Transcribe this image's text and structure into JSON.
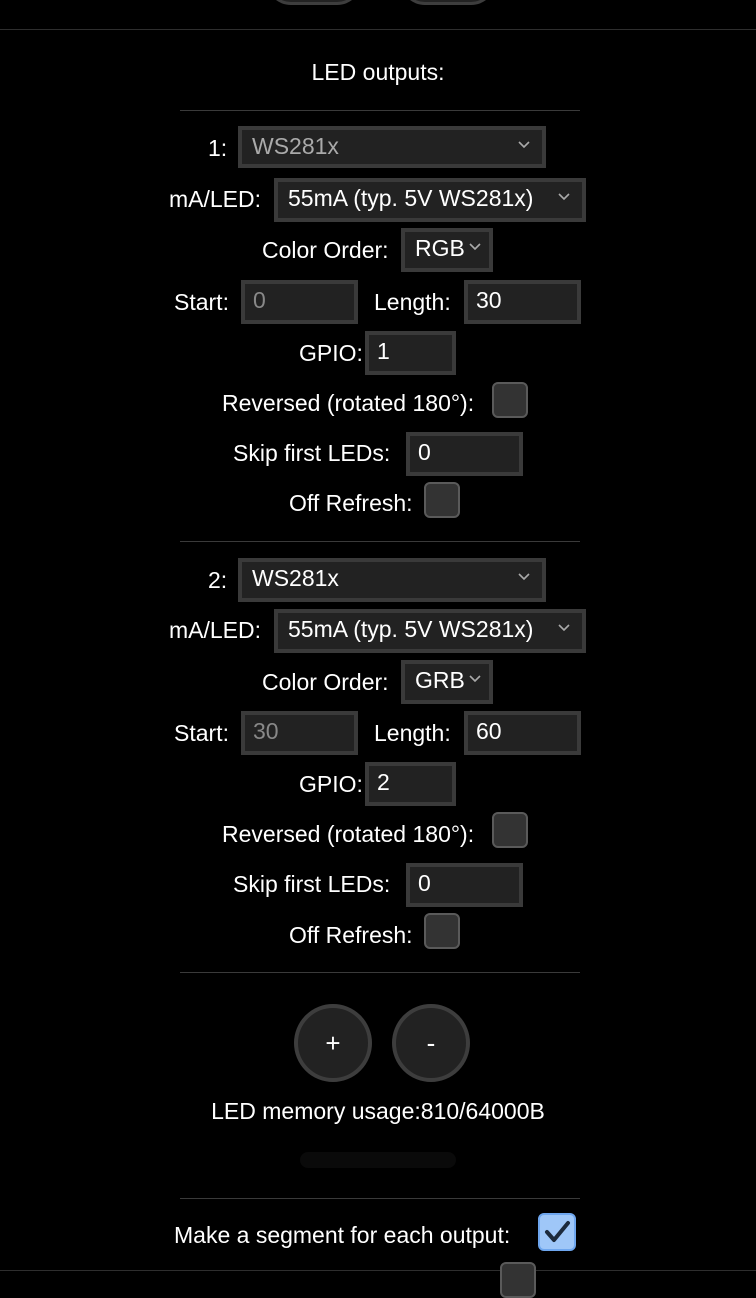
{
  "title": "LED outputs:",
  "outputs": [
    {
      "index_label": "1:",
      "type": "WS281x",
      "ma_label": "mA/LED:",
      "ma_value": "55mA (typ. 5V WS281x)",
      "color_order_label": "Color Order:",
      "color_order": "RGB",
      "start_label": "Start:",
      "start": "0",
      "length_label": "Length:",
      "length": "30",
      "gpio_label": "GPIO:",
      "gpio": "1",
      "reversed_label": "Reversed (rotated 180°):",
      "reversed": false,
      "skip_label": "Skip first LEDs:",
      "skip": "0",
      "off_refresh_label": "Off Refresh:",
      "off_refresh": false
    },
    {
      "index_label": "2:",
      "type": "WS281x",
      "ma_label": "mA/LED:",
      "ma_value": "55mA (typ. 5V WS281x)",
      "color_order_label": "Color Order:",
      "color_order": "GRB",
      "start_label": "Start:",
      "start": "30",
      "length_label": "Length:",
      "length": "60",
      "gpio_label": "GPIO:",
      "gpio": "2",
      "reversed_label": "Reversed (rotated 180°):",
      "reversed": false,
      "skip_label": "Skip first LEDs:",
      "skip": "0",
      "off_refresh_label": "Off Refresh:",
      "off_refresh": false
    }
  ],
  "buttons": {
    "add": "+",
    "remove": "-"
  },
  "memory": "LED memory usage:810/64000B",
  "segment_label": "Make a segment for each output:",
  "segment_checked": true,
  "colors": {
    "background": "#000000",
    "field": "#222222",
    "border": "#3a3a3a",
    "checked": "#9fc7f8"
  }
}
